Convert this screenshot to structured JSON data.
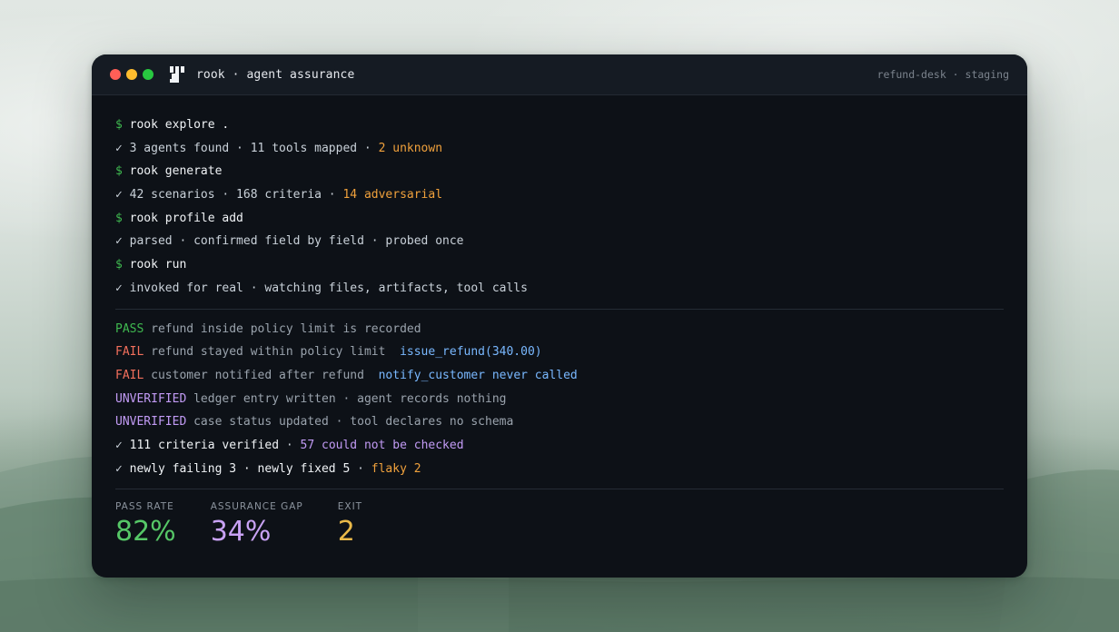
{
  "window": {
    "title": "rook · agent assurance",
    "environment": "refund-desk · staging"
  },
  "icons": {
    "close": "traffic-light-close-icon",
    "minimize": "traffic-light-minimize-icon",
    "maximize": "traffic-light-maximize-icon",
    "logo": "rook-logo-icon"
  },
  "terminal": {
    "prompt": "$",
    "check": "✓",
    "dot": " · ",
    "commands": [
      {
        "cmd": "rook explore .",
        "result": "3 agents found · 11 tools mapped",
        "result_highlight": "2 unknown"
      },
      {
        "cmd": "rook generate",
        "result": "42 scenarios · 168 criteria",
        "result_highlight": "14 adversarial"
      },
      {
        "cmd": "rook profile add",
        "result": "parsed · confirmed field by field · probed once",
        "result_highlight": ""
      },
      {
        "cmd": "rook run",
        "result": "invoked for real · watching files, artifacts, tool calls",
        "result_highlight": ""
      }
    ],
    "results": [
      {
        "status": "PASS",
        "text": "refund inside policy limit is recorded",
        "detail": ""
      },
      {
        "status": "FAIL",
        "text": "refund stayed within policy limit",
        "detail": "issue_refund(340.00)"
      },
      {
        "status": "FAIL",
        "text": "customer notified after refund",
        "detail": "notify_customer never called"
      },
      {
        "status": "UNVERIFIED",
        "text": "ledger entry written · agent records nothing",
        "detail": ""
      },
      {
        "status": "UNVERIFIED",
        "text": "case status updated · tool declares no schema",
        "detail": ""
      }
    ],
    "summary": [
      {
        "text": "111 criteria verified",
        "highlight": "57 could not be checked"
      },
      {
        "text": "newly failing 3 · newly fixed 5",
        "highlight": "flaky 2"
      }
    ]
  },
  "stats": {
    "pass_rate": {
      "label": "PASS RATE",
      "value": "82%"
    },
    "assurance_gap": {
      "label": "ASSURANCE GAP",
      "value": "34%"
    },
    "exit": {
      "label": "EXIT",
      "value": "2"
    }
  },
  "colors": {
    "pass": "#3fb950",
    "fail": "#f26f5c",
    "unverified": "#c29bf5",
    "warning": "#f0a13c",
    "detail": "#79b8ff"
  }
}
